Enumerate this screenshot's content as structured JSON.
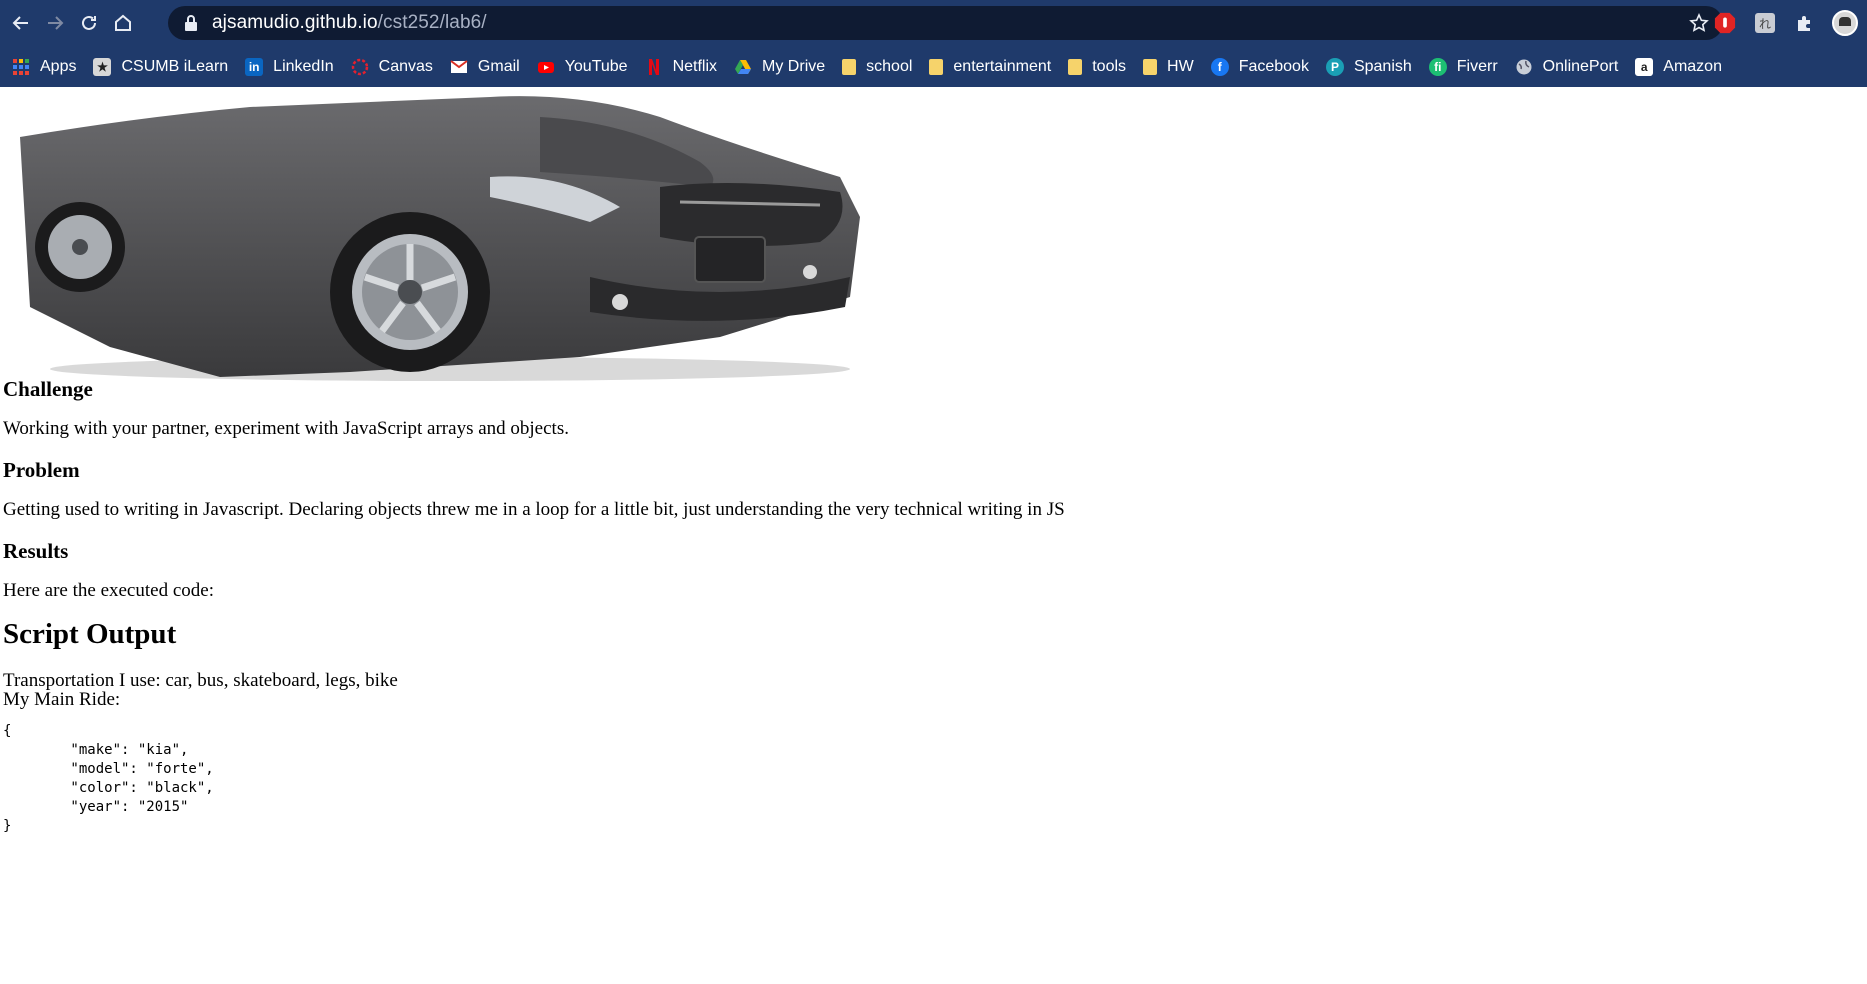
{
  "browser": {
    "url_domain": "ajsamudio.github.io",
    "url_path": "/cst252/lab6/",
    "bookmarks": [
      {
        "label": "Apps",
        "icon": "apps-grid-icon",
        "color": "#ffffff"
      },
      {
        "label": "CSUMB iLearn",
        "icon": "ilearn-icon",
        "color": "#d7d7d7"
      },
      {
        "label": "LinkedIn",
        "icon": "linkedin-icon",
        "color": "#0a66c2"
      },
      {
        "label": "Canvas",
        "icon": "canvas-icon",
        "color": "#e4202e"
      },
      {
        "label": "Gmail",
        "icon": "gmail-icon",
        "color": "#d93025"
      },
      {
        "label": "YouTube",
        "icon": "youtube-icon",
        "color": "#ff0000"
      },
      {
        "label": "Netflix",
        "icon": "netflix-icon",
        "color": "#e50914"
      },
      {
        "label": "My Drive",
        "icon": "drive-icon",
        "color": "#34a853"
      },
      {
        "label": "school",
        "icon": "folder-icon",
        "color": "#f6d36b"
      },
      {
        "label": "entertainment",
        "icon": "folder-icon",
        "color": "#f6d36b"
      },
      {
        "label": "tools",
        "icon": "folder-icon",
        "color": "#f6d36b"
      },
      {
        "label": "HW",
        "icon": "folder-icon",
        "color": "#f6d36b"
      },
      {
        "label": "Facebook",
        "icon": "facebook-icon",
        "color": "#1877f2"
      },
      {
        "label": "Spanish",
        "icon": "spanish-icon",
        "color": "#1a9fb5"
      },
      {
        "label": "Fiverr",
        "icon": "fiverr-icon",
        "color": "#1dbf73"
      },
      {
        "label": "OnlinePort",
        "icon": "globe-icon",
        "color": "#c8ced8"
      },
      {
        "label": "Amazon",
        "icon": "amazon-icon",
        "color": "#ffffff"
      }
    ]
  },
  "page": {
    "challenge_heading": "Challenge",
    "challenge_text": "Working with your partner, experiment with JavaScript arrays and objects.",
    "problem_heading": "Problem",
    "problem_text": "Getting used to writing in Javascript. Declaring objects threw me in a loop for a little bit, just understanding the very technical writing in JS",
    "results_heading": "Results",
    "results_text": "Here are the executed code:",
    "output_heading": "Script Output",
    "transport_line": "Transportation I use: car, bus, skateboard, legs, bike",
    "main_ride_label": "My Main Ride:",
    "json_output": "{\n        \"make\": \"kia\",\n        \"model\": \"forte\",\n        \"color\": \"black\",\n        \"year\": \"2015\"\n}"
  }
}
